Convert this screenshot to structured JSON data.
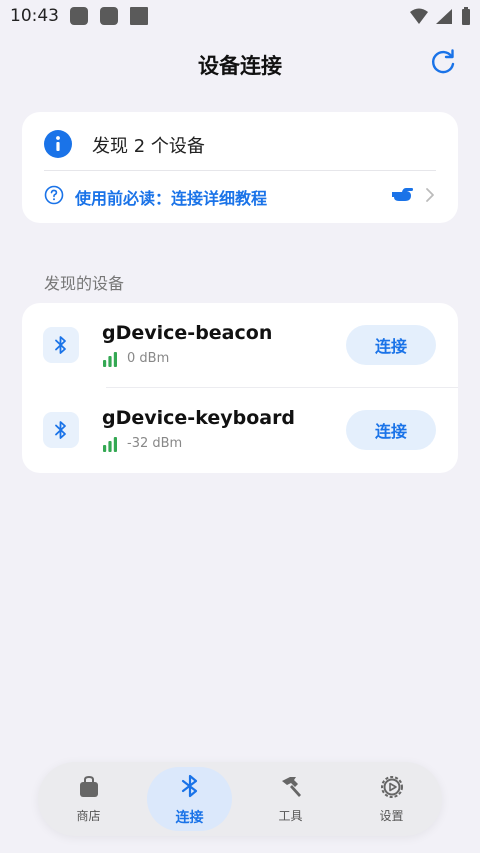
{
  "status_bar": {
    "time": "10:43"
  },
  "header": {
    "title": "设备连接"
  },
  "info_card": {
    "found_text": "发现 2 个设备",
    "help_text": "使用前必读：连接详细教程"
  },
  "devices_section": {
    "label": "发现的设备",
    "devices": [
      {
        "name": "gDevice-beacon",
        "rssi": "0 dBm",
        "button_label": "连接"
      },
      {
        "name": "gDevice-keyboard",
        "rssi": "-32 dBm",
        "button_label": "连接"
      }
    ]
  },
  "bottom_nav": {
    "items": [
      {
        "label": "商店",
        "icon": "shopping-bag-icon"
      },
      {
        "label": "连接",
        "icon": "bluetooth-icon",
        "active": true
      },
      {
        "label": "工具",
        "icon": "hammer-icon"
      },
      {
        "label": "设置",
        "icon": "settings-gear-icon"
      }
    ]
  },
  "colors": {
    "accent": "#1a73e8",
    "signal": "#34a853",
    "background": "#f2f1f7"
  }
}
